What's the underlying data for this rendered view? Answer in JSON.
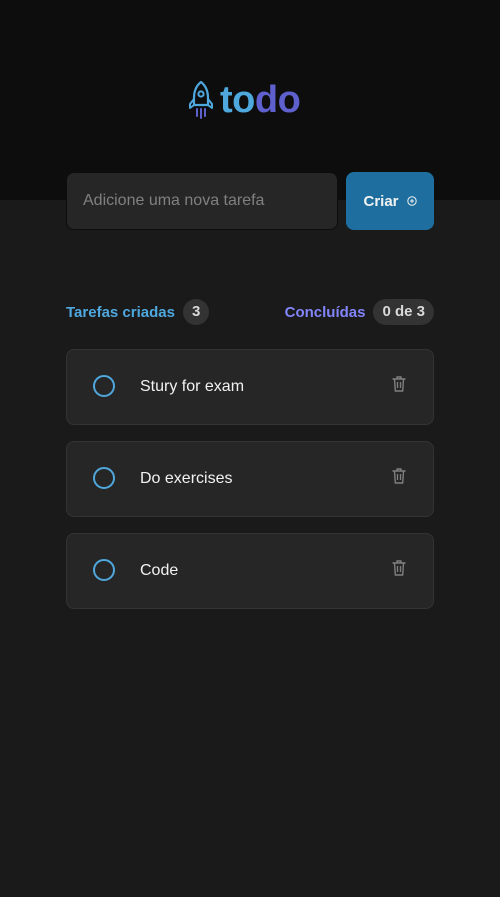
{
  "app": {
    "logo_text_part1": "to",
    "logo_text_part2": "do",
    "logo_icon": "rocket-icon"
  },
  "form": {
    "input_placeholder": "Adicione uma nova tarefa",
    "input_value": "",
    "create_label": "Criar",
    "create_icon": "plus-circle-icon"
  },
  "stats": {
    "created_label": "Tarefas criadas",
    "created_count": "3",
    "done_label": "Concluídas",
    "done_count": "0 de 3"
  },
  "tasks": [
    {
      "text": "Stury for exam",
      "completed": false
    },
    {
      "text": "Do exercises",
      "completed": false
    },
    {
      "text": "Code",
      "completed": false
    }
  ],
  "colors": {
    "blue": "#4ea8de",
    "purple": "#5e60ce",
    "button": "#1e6f9f",
    "background": "#1a1a1a",
    "header": "#0d0d0d"
  }
}
